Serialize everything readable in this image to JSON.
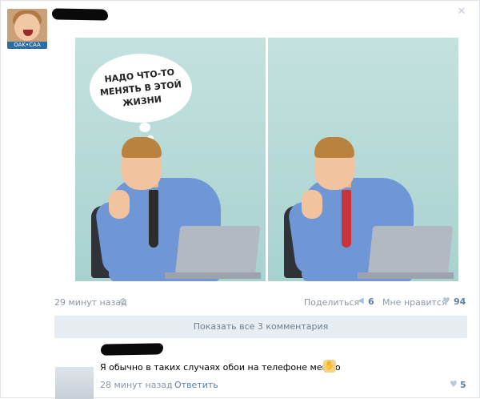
{
  "post": {
    "avatar_badge": "OAK•CAA",
    "comic": {
      "left_panel_thought": "надо что-то менять в этой жизни"
    },
    "meta": {
      "time": "29 минут назад",
      "share_label": "Поделиться",
      "share_count": "6",
      "like_label": "Мне нравится",
      "like_count": "94"
    },
    "show_comments_label": "Показать все 3 комментария"
  },
  "comment": {
    "text": "Я обычно в таких случаях обои на телефоне меняю",
    "time": "28 минут назад",
    "separator": "|",
    "reply_label": "Ответить",
    "like_count": "5"
  },
  "icons": {
    "close": "close-icon",
    "settings": "gear-icon",
    "share": "megaphone-icon",
    "heart": "heart-icon",
    "emoji": "praying-hands-icon"
  },
  "colors": {
    "link": "#5b7fa6",
    "muted": "#8a98a8",
    "button_bg": "#e8edf2",
    "comic_bg": "#b4d9d6"
  }
}
